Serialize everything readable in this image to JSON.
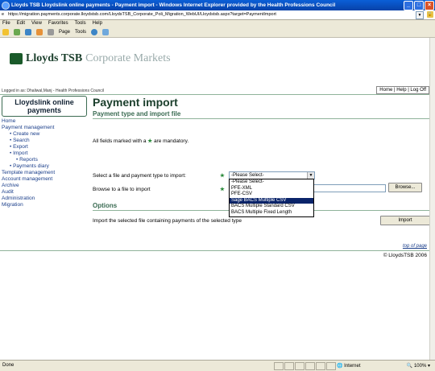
{
  "window": {
    "title": "Lloyds TSB Lloydslink online payments - Payment import - Windows Internet Explorer provided by the Health Professions Council"
  },
  "address": {
    "url": "https://migration.payments.corporate.lloydstsb.com/LloydsTSB_Corporate_Poli_Migration_WebUI/Lloydstsb.aspx?target=PaymentImport"
  },
  "menu": [
    "File",
    "Edit",
    "View",
    "Favorites",
    "Tools",
    "Help"
  ],
  "toolbar": {
    "page": "Page",
    "tools": "Tools"
  },
  "header": {
    "brand": "Lloyds TSB",
    "brand_sub": "Corporate Markets",
    "logged_in": "Logged in as: Dhaliwal,Manj - Health Professions Council",
    "toplinks": "Home | Help | Log Off"
  },
  "sidebar": {
    "title": "Lloydslink online payments",
    "items": [
      {
        "label": "Home",
        "level": 0
      },
      {
        "label": "Payment management",
        "level": 0
      },
      {
        "label": "• Create new",
        "level": 1
      },
      {
        "label": "• Search",
        "level": 1
      },
      {
        "label": "• Export",
        "level": 1
      },
      {
        "label": "• Import",
        "level": 1
      },
      {
        "label": "• Reports",
        "level": 2
      },
      {
        "label": "• Payments diary",
        "level": 1
      },
      {
        "label": "Template management",
        "level": 0
      },
      {
        "label": "Account management",
        "level": 0
      },
      {
        "label": "Archive",
        "level": 0
      },
      {
        "label": "Audit",
        "level": 0
      },
      {
        "label": "Administration",
        "level": 0
      },
      {
        "label": "Migration",
        "level": 0
      }
    ]
  },
  "main": {
    "title": "Payment import",
    "section1": "Payment type and import file",
    "mandatory_pre": "All fields marked with a",
    "mandatory_post": "are mandatory.",
    "select_label": "Select a file and payment type to import:",
    "browse_label": "Browse to a file to import",
    "select_value": "-Please Select-",
    "options": [
      "-Please Select-",
      "PFE-XML",
      "PFE-CSV",
      "Sage BACS Multiple CSV",
      "BACS Multiple Standard CSV",
      "BACS Multiple Fixed Length"
    ],
    "selected_option_index": 3,
    "browse_button": "Browse...",
    "section2": "Options",
    "import_text": "Import the selected file containing payments of the selected type",
    "import_button": "Import",
    "top_of_page": "top of page",
    "copyright": "© LloydsTSB 2006"
  },
  "status": {
    "left": "Done",
    "zone": "Internet",
    "zoom": "100%"
  },
  "colors": {
    "title_bar": "#0842a8",
    "brand_green": "#1a3e2b",
    "link_blue": "#1a3e8a",
    "mandatory_star": "#2a8a3a",
    "selection": "#0a246a"
  }
}
